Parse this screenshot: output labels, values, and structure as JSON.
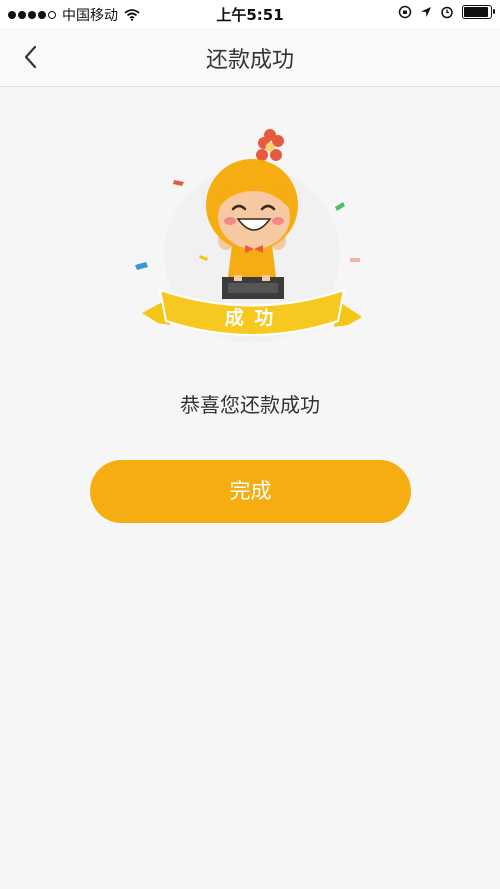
{
  "status_bar": {
    "carrier": "中国移动",
    "time": "上午5:51"
  },
  "header": {
    "title": "还款成功"
  },
  "illustration": {
    "banner_text": "成 功"
  },
  "main": {
    "message": "恭喜您还款成功",
    "done_label": "完成"
  },
  "colors": {
    "accent": "#f6ad12",
    "background": "#f6f6f6"
  }
}
